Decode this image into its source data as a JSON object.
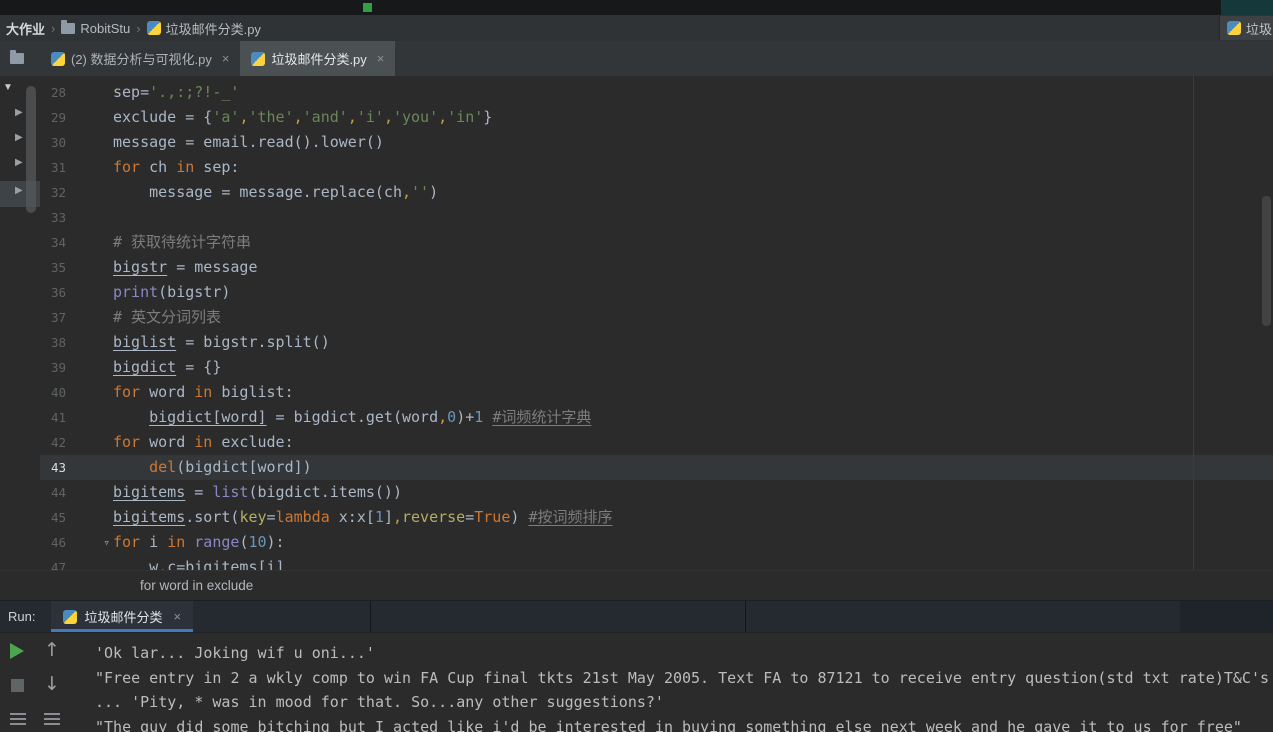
{
  "breadcrumb_bar": {
    "items": [
      {
        "label": "大作业",
        "icon": null
      },
      {
        "label": "RobitStu",
        "icon": "folder"
      },
      {
        "label": "垃圾邮件分类.py",
        "icon": "python"
      }
    ],
    "right_chip": {
      "label": "垃圾",
      "icon": "python"
    }
  },
  "tab_bar": {
    "tabs": [
      {
        "label": "(2) 数据分析与可视化.py",
        "icon": "python",
        "close": "×",
        "active": false
      },
      {
        "label": "垃圾邮件分类.py",
        "icon": "python",
        "close": "×",
        "active": true
      }
    ]
  },
  "editor": {
    "current_line": 43,
    "lines": [
      {
        "no": 28,
        "tokens": [
          [
            "p",
            "sep="
          ],
          [
            "str",
            "'.,:;?!-_'"
          ]
        ]
      },
      {
        "no": 29,
        "tokens": [
          [
            "p",
            "exclude = {"
          ],
          [
            "str",
            "'a'"
          ],
          [
            "wc",
            ","
          ],
          [
            "str",
            "'the'"
          ],
          [
            "wc",
            ","
          ],
          [
            "str",
            "'and'"
          ],
          [
            "wc",
            ","
          ],
          [
            "str",
            "'i'"
          ],
          [
            "wc",
            ","
          ],
          [
            "str",
            "'you'"
          ],
          [
            "wc",
            ","
          ],
          [
            "str",
            "'in'"
          ],
          [
            "p",
            "}"
          ]
        ]
      },
      {
        "no": 30,
        "tokens": [
          [
            "p",
            "message = email.read().lower()"
          ]
        ]
      },
      {
        "no": 31,
        "tokens": [
          [
            "kw",
            "for"
          ],
          [
            "p",
            " ch "
          ],
          [
            "kw",
            "in"
          ],
          [
            "p",
            " sep:"
          ]
        ]
      },
      {
        "no": 32,
        "tokens": [
          [
            "p",
            "    message = message.replace(ch"
          ],
          [
            "wc",
            ","
          ],
          [
            "str",
            "''"
          ],
          [
            "p",
            ")"
          ]
        ]
      },
      {
        "no": 33,
        "tokens": []
      },
      {
        "no": 34,
        "tokens": [
          [
            "com",
            "# 获取待统计字符串"
          ]
        ]
      },
      {
        "no": 35,
        "tokens": [
          [
            "und",
            "bigstr"
          ],
          [
            "p",
            " = message"
          ]
        ]
      },
      {
        "no": 36,
        "tokens": [
          [
            "fn",
            "print"
          ],
          [
            "p",
            "(bigstr)"
          ]
        ]
      },
      {
        "no": 37,
        "tokens": [
          [
            "com",
            "# 英文分词列表"
          ]
        ]
      },
      {
        "no": 38,
        "tokens": [
          [
            "und",
            "biglist"
          ],
          [
            "p",
            " = bigstr.split()"
          ]
        ]
      },
      {
        "no": 39,
        "tokens": [
          [
            "und",
            "bigdict"
          ],
          [
            "p",
            " = {}"
          ]
        ]
      },
      {
        "no": 40,
        "tokens": [
          [
            "kw",
            "for"
          ],
          [
            "p",
            " word "
          ],
          [
            "kw",
            "in"
          ],
          [
            "p",
            " biglist:"
          ]
        ]
      },
      {
        "no": 41,
        "tokens": [
          [
            "p",
            "    "
          ],
          [
            "und",
            "bigdict[word]"
          ],
          [
            "p",
            " = bigdict.get(word"
          ],
          [
            "wc",
            ","
          ],
          [
            "num",
            "0"
          ],
          [
            "p",
            ")+"
          ],
          [
            "num",
            "1"
          ],
          [
            "p",
            " "
          ],
          [
            "comu",
            "#词频统计字典"
          ]
        ]
      },
      {
        "no": 42,
        "tokens": [
          [
            "kw",
            "for"
          ],
          [
            "p",
            " word "
          ],
          [
            "kw",
            "in"
          ],
          [
            "p",
            " exclude:"
          ]
        ]
      },
      {
        "no": 43,
        "tokens": [
          [
            "p",
            "    "
          ],
          [
            "kw",
            "del"
          ],
          [
            "p",
            "(bigdict[word])"
          ]
        ]
      },
      {
        "no": 44,
        "tokens": [
          [
            "und",
            "bigitems"
          ],
          [
            "p",
            " = "
          ],
          [
            "fn",
            "list"
          ],
          [
            "p",
            "(bigdict.items())"
          ]
        ]
      },
      {
        "no": 45,
        "tokens": [
          [
            "und",
            "bigitems"
          ],
          [
            "p",
            ".sort("
          ],
          [
            "arg",
            "key"
          ],
          [
            "p",
            "="
          ],
          [
            "kw",
            "lambda"
          ],
          [
            "p",
            " x:x["
          ],
          [
            "num",
            "1"
          ],
          [
            "p",
            "]"
          ],
          [
            "wc",
            ","
          ],
          [
            "arg",
            "reverse"
          ],
          [
            "p",
            "="
          ],
          [
            "kw",
            "True"
          ],
          [
            "p",
            ") "
          ],
          [
            "comu",
            "#按词频排序"
          ]
        ]
      },
      {
        "no": 46,
        "fold": true,
        "tokens": [
          [
            "kw",
            "for"
          ],
          [
            "p",
            " i "
          ],
          [
            "kw",
            "in"
          ],
          [
            "p",
            " "
          ],
          [
            "fn",
            "range"
          ],
          [
            "p",
            "("
          ],
          [
            "num",
            "10"
          ],
          [
            "p",
            "):"
          ]
        ]
      },
      {
        "no": 47,
        "tokens": [
          [
            "p",
            "    w"
          ],
          [
            "wc",
            ","
          ],
          [
            "p",
            "c=bigitems[i]"
          ]
        ]
      }
    ]
  },
  "context_bar": {
    "text": "for word in exclude"
  },
  "run_panel": {
    "label": "Run:",
    "tab": {
      "label": "垃圾邮件分类",
      "icon": "python",
      "close": "×"
    }
  },
  "console": {
    "lines": [
      "'Ok lar... Joking wif u oni...'",
      "\"Free entry in 2 a wkly comp to win FA Cup final tkts 21st May 2005. Text FA to 87121 to receive entry question(std txt rate)T&C's",
      "... 'Pity, * was in mood for that. So...any other suggestions?'",
      "\"The guy did some bitching but I acted like i'd be interested in buying something else next week and he gave it to us for free\""
    ]
  },
  "icons": {
    "breadcrumb_sep": "›",
    "tree_expanded": "▼",
    "tree_collapsed": "▶",
    "fold": "▿",
    "up": "↑",
    "down": "↓"
  },
  "colors": {
    "editor_bg": "#2b2b2b",
    "keyword": "#cc7832",
    "string": "#6a8759",
    "number": "#6897bb",
    "comment": "#7d7d7d",
    "builtin": "#8888c6",
    "current_line": "#343739",
    "tab_active": "#4b5052",
    "run_tab_underline": "#3e7bbf",
    "run_play": "#4ca64f"
  }
}
